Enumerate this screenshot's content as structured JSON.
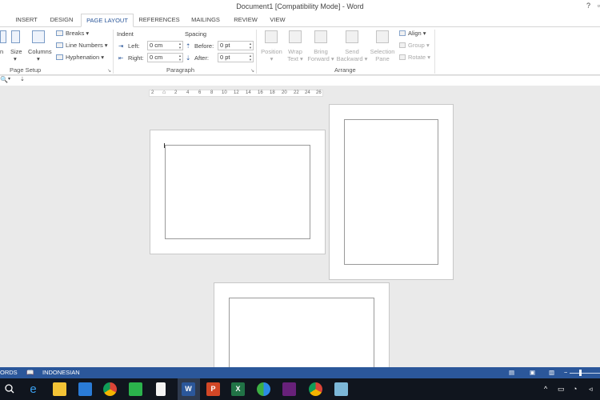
{
  "window": {
    "title": "Document1 [Compatibility Mode] - Word",
    "help": "?"
  },
  "tabs": [
    {
      "label": "INSERT"
    },
    {
      "label": "DESIGN"
    },
    {
      "label": "PAGE LAYOUT",
      "active": true
    },
    {
      "label": "REFERENCES"
    },
    {
      "label": "MAILINGS"
    },
    {
      "label": "REVIEW"
    },
    {
      "label": "VIEW"
    }
  ],
  "ribbon": {
    "page_setup": {
      "orientation": "n",
      "size": "Size",
      "columns": "Columns",
      "breaks": "Breaks",
      "line_numbers": "Line Numbers",
      "hyphenation": "Hyphenation",
      "label": "Page Setup"
    },
    "paragraph": {
      "indent_title": "Indent",
      "left_label": "Left:",
      "left_value": "0 cm",
      "right_label": "Right:",
      "right_value": "0 cm",
      "spacing_title": "Spacing",
      "before_label": "Before:",
      "before_value": "0 pt",
      "after_label": "After:",
      "after_value": "0 pt",
      "label": "Paragraph"
    },
    "arrange": {
      "position": [
        "Position",
        "▾"
      ],
      "wrap_text": [
        "Wrap",
        "Text ▾"
      ],
      "bring_forward": [
        "Bring",
        "Forward ▾"
      ],
      "send_backward": [
        "Send",
        "Backward ▾"
      ],
      "selection_pane": [
        "Selection",
        "Pane"
      ],
      "align": "Align",
      "group": "Group",
      "rotate": "Rotate",
      "label": "Arrange"
    }
  },
  "ruler": {
    "ticks": [
      "2",
      "2",
      "4",
      "6",
      "8",
      "10",
      "12",
      "14",
      "16",
      "18",
      "20",
      "22",
      "24",
      "26"
    ]
  },
  "statusbar": {
    "words": "ORDS",
    "language": "INDONESIAN"
  },
  "colors": {
    "accent": "#2b579a",
    "taskbar": "#10151e"
  },
  "taskbar": {
    "icons": [
      "search-icon",
      "edge-icon",
      "file-explorer-icon",
      "store-icon",
      "chrome-icon",
      "phone-icon",
      "notepad-icon",
      "word-icon",
      "powerpoint-icon",
      "excel-icon",
      "maps-icon",
      "visual-studio-icon",
      "chrome-alt-icon",
      "app-icon"
    ]
  }
}
